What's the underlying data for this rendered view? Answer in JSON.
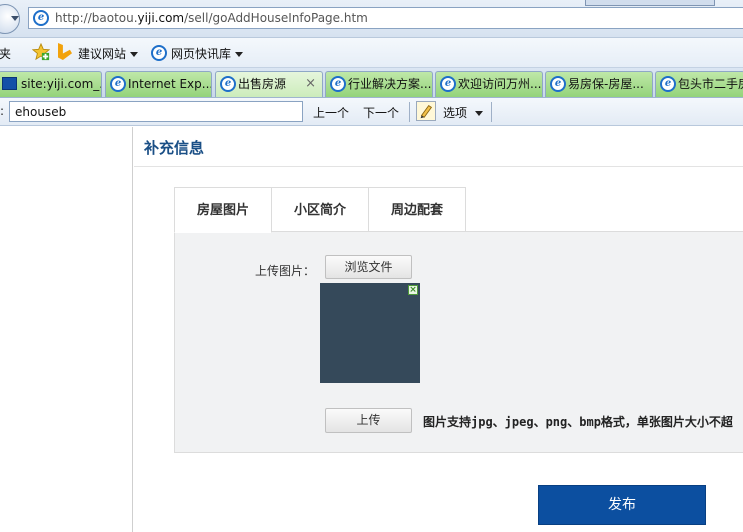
{
  "browser": {
    "address_url_prefix": "http://baotou.",
    "address_url_domain": "yiji.com",
    "address_url_path": "/sell/goAddHouseInfoPage.htm",
    "favorites_label_fragment": "夹",
    "favorites_items": [
      {
        "label": "建议网站"
      },
      {
        "label": "网页快讯库"
      }
    ],
    "tabs": [
      {
        "label": "site:yiji.com_..."
      },
      {
        "label": "Internet Exp..."
      },
      {
        "label": "出售房源",
        "active": true
      },
      {
        "label": "行业解决方案..."
      },
      {
        "label": "欢迎访问万州..."
      },
      {
        "label": "易房保-房屋..."
      },
      {
        "label": "包头市二手房"
      }
    ],
    "tab_close_glyph": "×",
    "find_bar": {
      "colon": ":",
      "query": "ehouseb",
      "prev_label": "上一个",
      "next_label": "下一个",
      "options_label": "选项"
    }
  },
  "page": {
    "section_title": "补充信息",
    "tabs": [
      {
        "label": "房屋图片",
        "active": true
      },
      {
        "label": "小区简介"
      },
      {
        "label": "周边配套"
      }
    ],
    "upload_label": "上传图片：",
    "browse_button": "浏览文件",
    "upload_button": "上传",
    "format_note": "图片支持jpg、jpeg、png、bmp格式，单张图片大小不超",
    "preview_close_glyph": "×",
    "publish_button": "发布"
  }
}
